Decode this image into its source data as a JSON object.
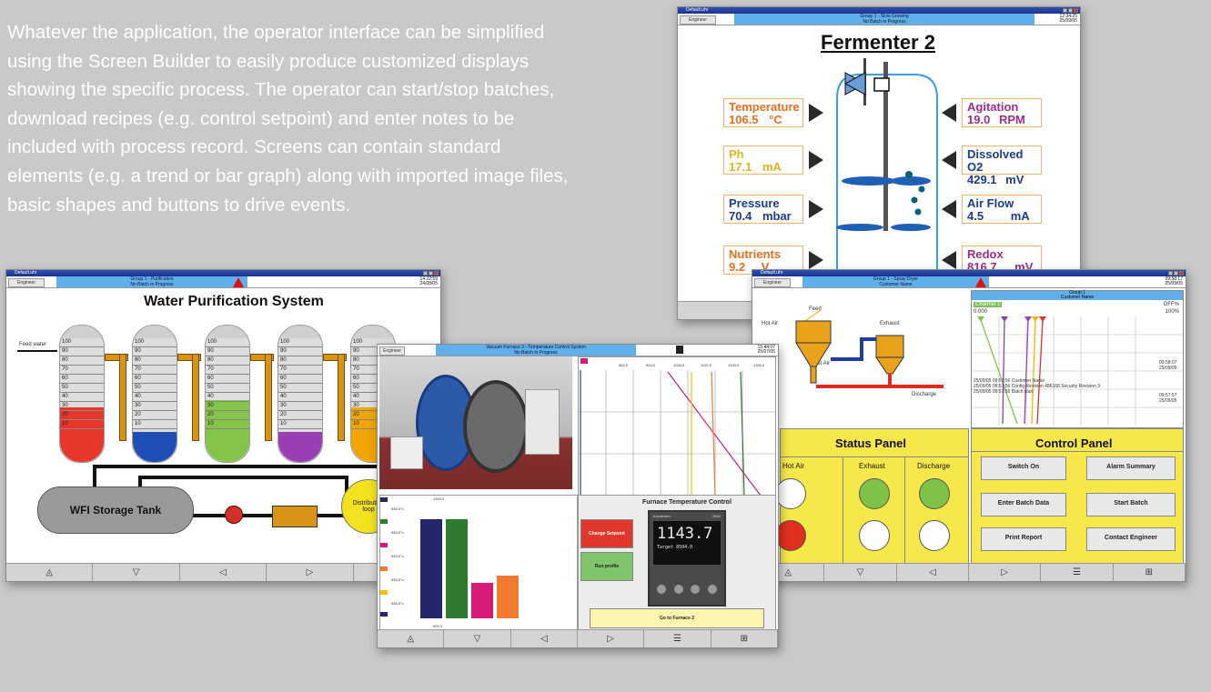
{
  "intro": {
    "lines": [
      "Whatever the application, the operator interface can be simplified",
      "using the Screen Builder to easily produce customized displays",
      "showing the specific process. The operator can start/stop batches,",
      "download recipes (e.g. control setpoint) and enter notes to be",
      "included with process record. Screens can contain standard",
      "elements (e.g. a trend or bar graph) along with imported image files,",
      "basic shapes and buttons to drive events."
    ]
  },
  "common": {
    "window_title": "Default.uhr",
    "engineer": "Engineer",
    "nav": [
      "◬",
      "▽",
      "◁",
      "▷",
      "☰",
      "⊞"
    ]
  },
  "fermenter": {
    "group_line1": "Group 1 - Slow Growing",
    "group_line2": "No Batch in Progress",
    "clock_time": "12:34:25",
    "clock_date": "25/09/05",
    "title": "Fermenter 2",
    "tags": [
      {
        "name": "Temperature",
        "value": "106.5",
        "unit": "°C"
      },
      {
        "name": "Ph",
        "value": "17.1",
        "unit": "mA"
      },
      {
        "name": "Pressure",
        "value": "70.4",
        "unit": "mbar"
      },
      {
        "name": "Nutrients",
        "value": "9.2",
        "unit": "V"
      },
      {
        "name": "Agitation",
        "value": "19.0",
        "unit": "RPM"
      },
      {
        "name": "Dissolved O2",
        "value": "429.1",
        "unit": "mV"
      },
      {
        "name": "Air Flow",
        "value": "4.5",
        "unit": "mA"
      },
      {
        "name": "Redox",
        "value": "816.7",
        "unit": "mV"
      }
    ]
  },
  "water": {
    "group_line1": "Group 1 - Purification",
    "group_line2": "No Batch in Progress",
    "clock_time": "14:22:59",
    "clock_date": "24/08/05",
    "title": "Water Purification System",
    "feed_label": "Feed water",
    "tank_label": "WFI Storage Tank",
    "distribution_label": "Distribution loop",
    "scale": [
      "100",
      "90",
      "80",
      "70",
      "60",
      "50",
      "40",
      "30",
      "20",
      "10"
    ],
    "tube_levels": [
      0.4,
      0.22,
      0.45,
      0.22,
      0.4
    ],
    "tube_colors": [
      "#e8362b",
      "#1f4fb5",
      "#84c44a",
      "#9a3fb3",
      "#f2a500"
    ]
  },
  "vacuum": {
    "group_line1": "Vacuum Furnace 3 - Temperature Control System",
    "group_line2": "No Batch in Progress",
    "clock_time": "15:44:07",
    "clock_date": "25/07/05",
    "tick_labels": [
      "800.0",
      "900.0",
      "1000.0",
      "1100.0",
      "1200.0",
      "1300.0"
    ],
    "panel_title": "Furnace Temperature Control",
    "change_setpoint": "Change Setpoint",
    "run_profile": "Run profile",
    "go_to": "Go to Furnace 2",
    "bar_values": [
      0.84,
      0.84,
      0.3,
      0.36,
      0.0
    ],
    "bar_colors": [
      "#24266b",
      "#2e7a2e",
      "#d81b78",
      "#f47a30",
      "#f4c200"
    ],
    "bar_scale_top": "1300.0",
    "bar_scale_bottom": "900.0",
    "bar_values_text": [
      "955.5°c",
      "955.5°c",
      "955.5°c",
      "955.5°c",
      "955.5°c"
    ],
    "controller_brand": "Eurotherm",
    "controller_model": "3504",
    "controller_value": "1143.7",
    "controller_target": "Target  8504.0"
  },
  "spray": {
    "group_line1": "Group 1 - Spray Dryer",
    "group_line2": "Customer Name",
    "clock_time": "09:58:17",
    "clock_date": "25/09/05",
    "feed": "Feed",
    "hot_air": "Hot Air",
    "exhaust": "Exhaust",
    "moist_air": "Moist Air",
    "discharge": "Discharge",
    "trend_group_line1": "Group 1",
    "trend_group_line2": "Customer Name",
    "trend_channel": "Channel 1",
    "trend_value": "OFF%",
    "trend_min": "0.000",
    "trend_max": "100%",
    "trend_notes": [
      "25/09/05 09:57:56 Customer Name",
      "25/09/05 09:57:56 Config Revision 486168 Security Revision 3",
      "25/09/05 09:57:56 Batch start"
    ],
    "trend_times": [
      "09:58:07 25/09/05",
      "09:57:57 25/09/05"
    ],
    "status_title": "Status Panel",
    "status_cols": [
      "Hot Air",
      "Exhaust",
      "Discharge"
    ],
    "control_title": "Control Panel",
    "buttons": [
      "Switch On",
      "Alarm Summary",
      "Enter Batch Data",
      "Start Batch",
      "Print Report",
      "Contact Engineer"
    ]
  },
  "colors": {
    "panel_yellow": "#f6e84a",
    "header_blue": "#5fb0ea",
    "titlebar_blue": "#2f4fb0",
    "tag_border": "#f2b46a"
  }
}
